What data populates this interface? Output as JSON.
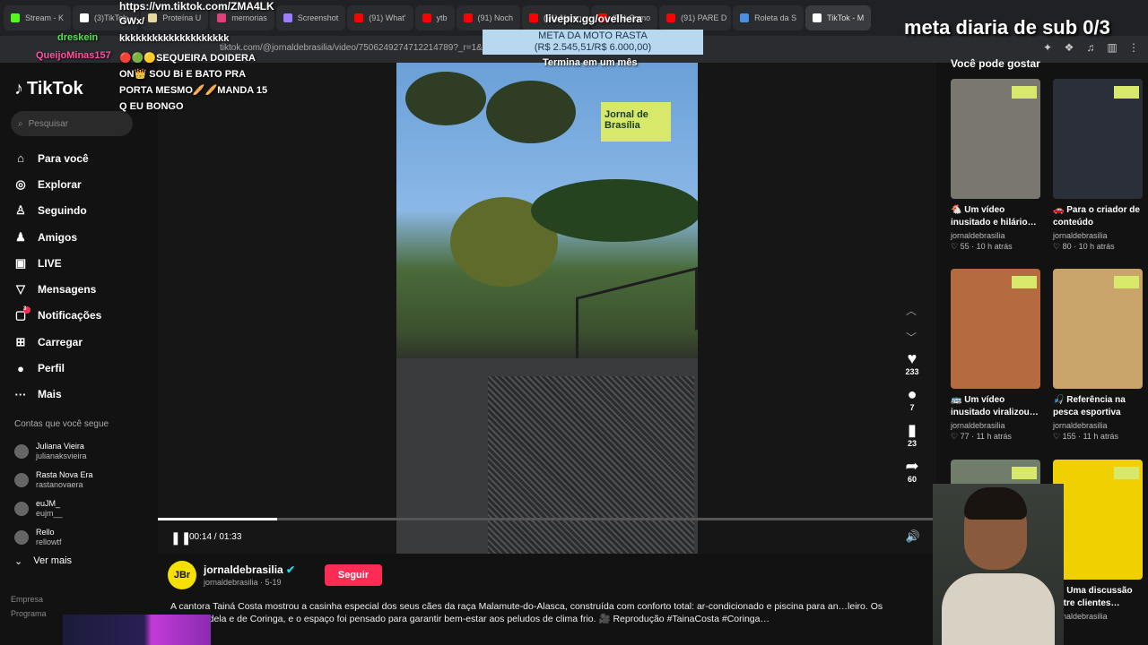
{
  "browser": {
    "tabs": [
      {
        "label": "Stream - K",
        "color": "#53fc18"
      },
      {
        "label": "(3)TikTok -",
        "color": "#ffffff"
      },
      {
        "label": "Proteína U",
        "color": "#e8d8a0"
      },
      {
        "label": "memorias",
        "color": "#e0407a"
      },
      {
        "label": "Screenshot",
        "color": "#9b7dff"
      },
      {
        "label": "(91) What'",
        "color": "#ff0000"
      },
      {
        "label": "ytb",
        "color": "#ff0000"
      },
      {
        "label": "(91) Noch",
        "color": "#ff0000"
      },
      {
        "label": "(91) Natan",
        "color": "#ff0000"
      },
      {
        "label": "(91) Como",
        "color": "#ff0000"
      },
      {
        "label": "(91) PARE D",
        "color": "#ff0000"
      },
      {
        "label": "Roleta da S",
        "color": "#4a90e2"
      },
      {
        "label": "TikTok - M",
        "color": "#ffffff"
      }
    ],
    "url": "tiktok.com/@jornaldebrasilia/video/7506249274712214789?_r=1&_t=Z"
  },
  "sidebar": {
    "logo": "TikTok",
    "search_placeholder": "Pesquisar",
    "nav": [
      {
        "label": "Para você",
        "icon": "home-icon",
        "glyph": "⌂"
      },
      {
        "label": "Explorar",
        "icon": "compass-icon",
        "glyph": "◎"
      },
      {
        "label": "Seguindo",
        "icon": "following-icon",
        "glyph": "♙"
      },
      {
        "label": "Amigos",
        "icon": "friends-icon",
        "glyph": "♟"
      },
      {
        "label": "LIVE",
        "icon": "live-icon",
        "glyph": "▣"
      },
      {
        "label": "Mensagens",
        "icon": "messages-icon",
        "glyph": "▽"
      },
      {
        "label": "Notificações",
        "icon": "notifications-icon",
        "glyph": "▢",
        "badge": "3"
      },
      {
        "label": "Carregar",
        "icon": "upload-icon",
        "glyph": "⊞"
      },
      {
        "label": "Perfil",
        "icon": "profile-icon",
        "glyph": "●"
      },
      {
        "label": "Mais",
        "icon": "more-icon",
        "glyph": "···"
      }
    ],
    "following_title": "Contas que você segue",
    "following": [
      {
        "name": "Juliana Vieira",
        "user": "julianaksvieira"
      },
      {
        "name": "Rasta Nova Era",
        "user": "rastanovaera"
      },
      {
        "name": "euJM_",
        "user": "eujm__"
      },
      {
        "name": "Rello",
        "user": "rellowtf"
      }
    ],
    "see_more": "Ver mais",
    "empresa": "Empresa",
    "programa": "Programa"
  },
  "video": {
    "watermark": "Jornal de Brasília",
    "time": "00:14 / 01:33",
    "progress": 0.153,
    "likes": "233",
    "comments": "7",
    "saves": "23",
    "shares": "60"
  },
  "post": {
    "avatar_text": "JBr",
    "author": "jornaldebrasilia",
    "sub": "jornaldebrasilia · 5-19",
    "follow_label": "Seguir",
    "caption": "A cantora Tainá Costa mostrou a casinha especial dos seus cães da raça Malamute-do-Alasca, construída com conforto total: ar-condicionado e piscina para an…leiro. Os pets são dela e de Coringa, e o espaço foi pensado para garantir bem-estar aos peludos de clima frio. 🎥 Reprodução #TainaCosta #Coringa…"
  },
  "recommendations": {
    "title": "Você pode gostar",
    "items": [
      {
        "title": "🐔 Um vídeo inusitado e hilário…",
        "author": "jornaldebrasilia",
        "meta": "♡ 55 · 10 h atrás",
        "color": "#7a7670"
      },
      {
        "title": "🚗 Para o criador de conteúdo Henrique…",
        "author": "jornaldebrasilia",
        "meta": "♡ 80 · 10 h atrás",
        "color": "#2a2f3a"
      },
      {
        "title": "🚌 Um vídeo inusitado viralizou…",
        "author": "jornaldebrasilia",
        "meta": "♡ 77 · 11 h atrás",
        "color": "#b36b3f"
      },
      {
        "title": "🎣 Referência na pesca esportiva no…",
        "author": "jornaldebrasilia",
        "meta": "♡ 155 · 11 h atrás",
        "color": "#c9a46a"
      },
      {
        "title": "",
        "author": "",
        "meta": "",
        "color": "#6f7d6a"
      },
      {
        "title": "📦 Uma discussão entre clientes…",
        "author": "jornaldebrasilia",
        "meta": "",
        "color": "#f0d000"
      }
    ]
  },
  "overlay": {
    "tiktok_link": "https://vm.tiktok.com/ZMA4LK",
    "gwx": "GWx/",
    "chat1_user": "dreskein",
    "chat1_msg": "kkkkkkkkkkkkkkkkkkkk",
    "chat2_user": "QueijoMinas157",
    "chat2_msg": "🔴🟢🟡SEQUEIRA DOIDERA ON👑 SOU Bi E BATO PRA PORTA MESMO🥖🥖MANDA 15 Q EU BONGO",
    "livepix": "livepix.gg/ovelhera",
    "meta_title": "META DA MOTO RASTA",
    "meta_value": "(R$ 2.545,51/R$ 6.000,00)",
    "termina": "Termina em um mês",
    "meta_diaria": "meta diaria de sub 0/3"
  }
}
